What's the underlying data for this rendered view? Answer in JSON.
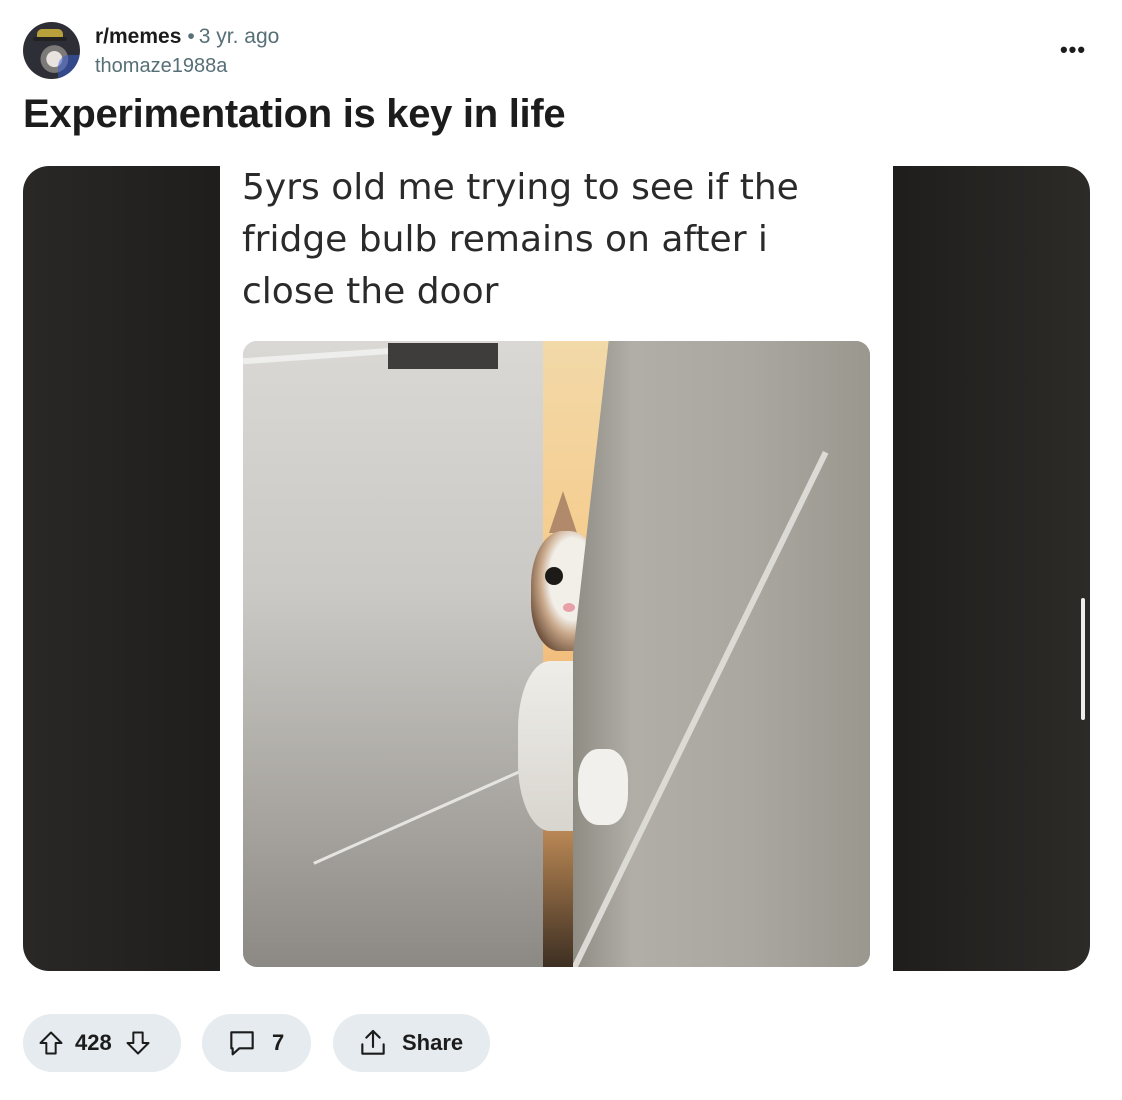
{
  "post": {
    "subreddit": "r/memes",
    "separator": "•",
    "age": "3 yr. ago",
    "author": "thomaze1988a",
    "title": "Experimentation is key in life",
    "overflow_label": "•••"
  },
  "media": {
    "caption": "5yrs old me trying to see if the fridge bulb remains on after i close the door"
  },
  "actions": {
    "vote_count": "428",
    "comment_count": "7",
    "share_label": "Share"
  },
  "icons": {
    "upvote": "upvote-arrow-icon",
    "downvote": "downvote-arrow-icon",
    "comment": "comment-bubble-icon",
    "share": "share-upload-icon",
    "overflow": "more-options-icon"
  }
}
